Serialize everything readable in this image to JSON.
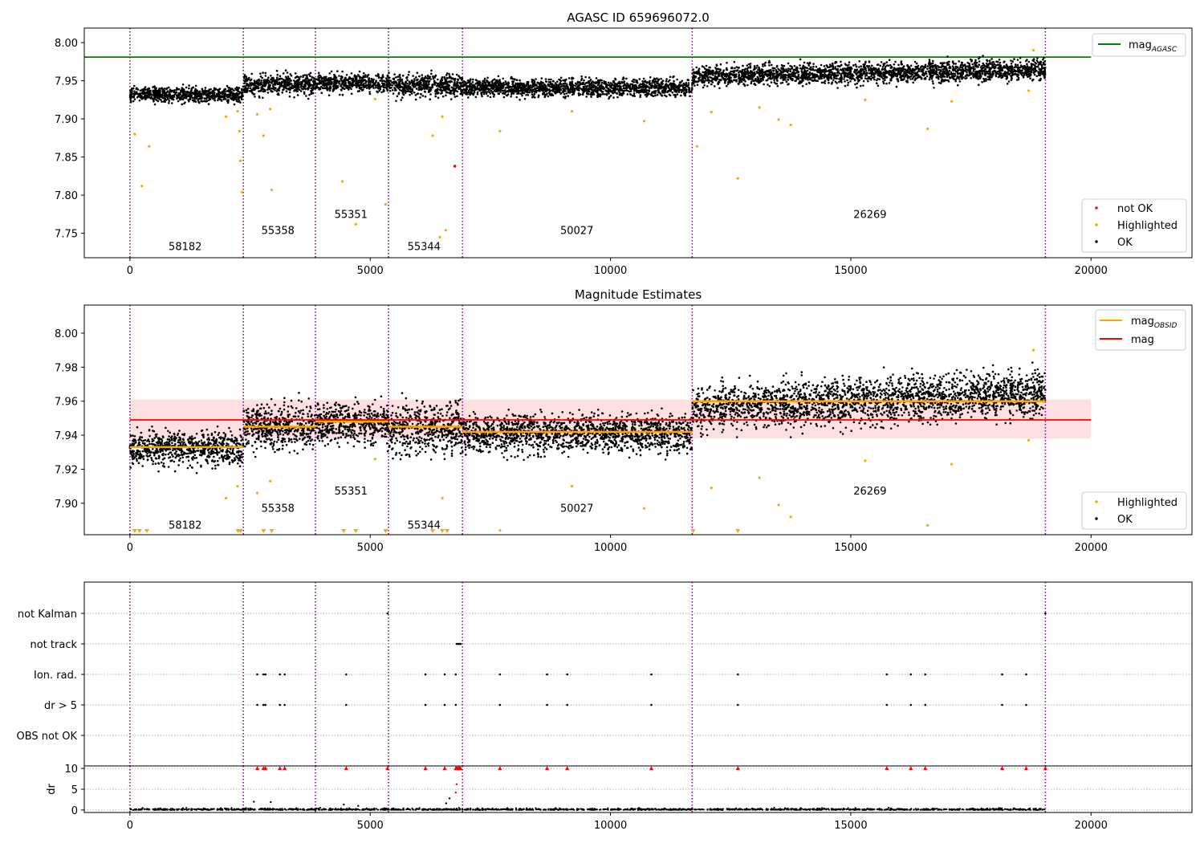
{
  "chart_data": [
    {
      "type": "scatter",
      "title": "AGASC ID 659696072.0",
      "xlim": [
        -950,
        22100
      ],
      "ylim": [
        7.718,
        8.019
      ],
      "x_ticks": [
        0,
        5000,
        10000,
        15000,
        20000
      ],
      "x_tick_labels": [
        "0",
        "5000",
        "10000",
        "15000",
        "20000"
      ],
      "y_ticks": [
        7.75,
        7.8,
        7.85,
        7.9,
        7.95,
        8.0
      ],
      "y_tick_labels": [
        "7.75",
        "7.80",
        "7.85",
        "7.90",
        "7.95",
        "8.00"
      ],
      "hlines": [
        {
          "name": "mag_AGASC",
          "y": 7.981,
          "x_end": 20000,
          "color": "#008000"
        }
      ],
      "vlines": [
        0,
        2360,
        3860,
        5380,
        6920,
        11700,
        19050
      ],
      "obsids": [
        {
          "label": "58182",
          "x": 1150,
          "y": 7.728
        },
        {
          "label": "55358",
          "x": 3080,
          "y": 7.749
        },
        {
          "label": "55351",
          "x": 4600,
          "y": 7.77
        },
        {
          "label": "55344",
          "x": 6120,
          "y": 7.728
        },
        {
          "label": "50027",
          "x": 9300,
          "y": 7.749
        },
        {
          "label": "26269",
          "x": 15400,
          "y": 7.77
        }
      ],
      "segments": [
        {
          "x": [
            0,
            2360
          ],
          "center": 7.932,
          "spread": 0.009
        },
        {
          "x": [
            2360,
            3860
          ],
          "center": 7.945,
          "spread": 0.012
        },
        {
          "x": [
            3860,
            5380
          ],
          "center": 7.947,
          "spread": 0.01
        },
        {
          "x": [
            5380,
            6920
          ],
          "center": 7.944,
          "spread": 0.013
        },
        {
          "x": [
            6920,
            11700
          ],
          "center": 7.941,
          "spread": 0.01
        },
        {
          "x": [
            11700,
            19050
          ],
          "center": 7.956,
          "spread": 0.012,
          "slope": 1.2e-06
        }
      ],
      "highlighted_outliers": [
        [
          100,
          7.88
        ],
        [
          250,
          7.812
        ],
        [
          400,
          7.864
        ],
        [
          2000,
          7.903
        ],
        [
          2240,
          7.91
        ],
        [
          2280,
          7.884
        ],
        [
          2300,
          7.845
        ],
        [
          2330,
          7.804
        ],
        [
          2650,
          7.906
        ],
        [
          2780,
          7.878
        ],
        [
          2950,
          7.807
        ],
        [
          2920,
          7.913
        ],
        [
          4420,
          7.818
        ],
        [
          4700,
          7.762
        ],
        [
          5100,
          7.926
        ],
        [
          5320,
          7.788
        ],
        [
          6300,
          7.878
        ],
        [
          6450,
          7.745
        ],
        [
          6570,
          7.754
        ],
        [
          6500,
          7.903
        ],
        [
          7700,
          7.884
        ],
        [
          9200,
          7.91
        ],
        [
          10700,
          7.897
        ],
        [
          11800,
          7.864
        ],
        [
          12100,
          7.909
        ],
        [
          12650,
          7.822
        ],
        [
          13100,
          7.915
        ],
        [
          13500,
          7.899
        ],
        [
          13750,
          7.892
        ],
        [
          15300,
          7.925
        ],
        [
          16600,
          7.887
        ],
        [
          17100,
          7.923
        ],
        [
          18800,
          7.99
        ],
        [
          18700,
          7.937
        ]
      ],
      "not_ok_points": [
        [
          6760,
          7.838
        ]
      ],
      "legend": {
        "position": "lower-right",
        "entries": [
          {
            "label": "not OK",
            "color": "#ff0000"
          },
          {
            "label": "Highlighted",
            "color": "#ffa500"
          },
          {
            "label": "OK",
            "color": "#000000"
          }
        ]
      },
      "legend_top": {
        "position": "upper-right",
        "entries": [
          {
            "label_main": "mag",
            "label_sub": "AGASC",
            "color": "#008000"
          }
        ]
      }
    },
    {
      "type": "scatter",
      "title": "Magnitude Estimates",
      "xlim": [
        -950,
        22100
      ],
      "ylim": [
        7.8815,
        8.0165
      ],
      "x_ticks": [
        0,
        5000,
        10000,
        15000,
        20000
      ],
      "x_tick_labels": [
        "0",
        "5000",
        "10000",
        "15000",
        "20000"
      ],
      "y_ticks": [
        7.9,
        7.92,
        7.94,
        7.96,
        7.98,
        8.0
      ],
      "y_tick_labels": [
        "7.90",
        "7.92",
        "7.94",
        "7.96",
        "7.98",
        "8.00"
      ],
      "mag": 7.949,
      "mag_band": [
        7.938,
        7.961
      ],
      "mag_obsid": [
        {
          "x": [
            0,
            2360
          ],
          "y": 7.933
        },
        {
          "x": [
            2360,
            3860
          ],
          "y": 7.945
        },
        {
          "x": [
            3860,
            5380
          ],
          "y": 7.948
        },
        {
          "x": [
            5380,
            6920
          ],
          "y": 7.945
        },
        {
          "x": [
            6920,
            11700
          ],
          "y": 7.942
        },
        {
          "x": [
            11700,
            19050
          ],
          "y": 7.96
        }
      ],
      "vlines": [
        0,
        2360,
        3860,
        5380,
        6920,
        11700,
        19050
      ],
      "obsids": [
        {
          "label": "58182",
          "x": 1150,
          "y": 7.885
        },
        {
          "label": "55358",
          "x": 3080,
          "y": 7.895
        },
        {
          "label": "55351",
          "x": 4600,
          "y": 7.905
        },
        {
          "label": "55344",
          "x": 6120,
          "y": 7.885
        },
        {
          "label": "50027",
          "x": 9300,
          "y": 7.895
        },
        {
          "label": "26269",
          "x": 15400,
          "y": 7.905
        }
      ],
      "below_range_markers": [
        100,
        200,
        350,
        2250,
        2300,
        2780,
        2950,
        4450,
        4700,
        5320,
        6300,
        6500,
        6600,
        11720,
        12650
      ],
      "legend": {
        "position": "lower-right",
        "entries": [
          {
            "label": "Highlighted",
            "color": "#ffa500"
          },
          {
            "label": "OK",
            "color": "#000000"
          }
        ]
      },
      "legend_top": {
        "position": "upper-right",
        "entries": [
          {
            "label_main": "mag",
            "label_sub": "OBSID",
            "color": "#ffa500"
          },
          {
            "label_main": "mag",
            "label_sub": "",
            "color": "#ff0000"
          }
        ]
      }
    },
    {
      "type": "scatter",
      "title": "",
      "xlim": [
        -950,
        22100
      ],
      "x_ticks": [
        0,
        5000,
        10000,
        15000,
        20000
      ],
      "x_tick_labels": [
        "0",
        "5000",
        "10000",
        "15000",
        "20000"
      ],
      "flag_rows": [
        "not Kalman",
        "not track",
        "Ion. rad.",
        "dr > 5",
        "OBS not OK"
      ],
      "flag_points": {
        "not Kalman": [
          5360,
          19050
        ],
        "not track": [
          6800,
          6830,
          6860,
          6880
        ],
        "Ion. rad.": [
          2650,
          2780,
          2820,
          3120,
          3220,
          4500,
          6150,
          6550,
          6780,
          7700,
          8680,
          9100,
          10850,
          12650,
          15750,
          16250,
          16550,
          18150,
          18650
        ],
        "dr > 5": [
          2650,
          2780,
          2820,
          3120,
          3220,
          4500,
          6150,
          6550,
          6780,
          7700,
          8680,
          9100,
          10850,
          12650,
          15750,
          16250,
          16550,
          18150,
          18650
        ],
        "OBS not OK": []
      },
      "dr": {
        "ylim": [
          -0.6,
          10.6
        ],
        "y_ticks": [
          0,
          5,
          10
        ],
        "y_tick_labels": [
          "0",
          "5",
          "10"
        ],
        "ylabel": "dr",
        "capped_points": [
          2650,
          2780,
          2820,
          3120,
          3220,
          4500,
          5360,
          6150,
          6550,
          6780,
          6800,
          6820,
          6840,
          6860,
          6880,
          7700,
          8680,
          9100,
          10850,
          12650,
          15750,
          16250,
          16550,
          18150,
          18650,
          19050
        ],
        "spike_points": [
          [
            6580,
            1.6
          ],
          [
            6650,
            2.8
          ],
          [
            6780,
            4.2
          ],
          [
            6800,
            6.2
          ],
          [
            2580,
            2.0
          ],
          [
            2930,
            1.9
          ],
          [
            4450,
            1.3
          ],
          [
            4750,
            1.0
          ]
        ]
      },
      "vlines": [
        0,
        2360,
        3860,
        5380,
        6920,
        11700,
        19050
      ]
    }
  ]
}
